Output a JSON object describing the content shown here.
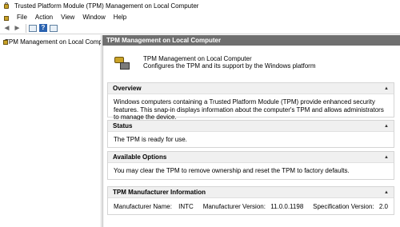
{
  "window": {
    "title": "Trusted Platform Module (TPM) Management on Local Computer"
  },
  "menu": {
    "items": [
      "File",
      "Action",
      "View",
      "Window",
      "Help"
    ]
  },
  "toolbar": {
    "back": "◄",
    "forward": "►",
    "help_glyph": "?"
  },
  "navigation": {
    "item_label": "TPM Management on Local Comp"
  },
  "content": {
    "header": "TPM Management on Local Computer",
    "intro_title": "TPM Management on Local Computer",
    "intro_subtitle": "Configures the TPM and its support by the Windows platform",
    "sections": {
      "overview": {
        "title": "Overview",
        "text": "Windows computers containing a Trusted Platform Module (TPM) provide enhanced security features. This snap-in displays information about the computer's TPM and allows administrators to manage the device."
      },
      "status": {
        "title": "Status",
        "text": "The TPM is ready for use."
      },
      "options": {
        "title": "Available Options",
        "text": "You may clear the TPM to remove ownership and reset the TPM to factory defaults."
      },
      "manufacturer": {
        "title": "TPM Manufacturer Information",
        "name_label": "Manufacturer Name:",
        "name_value": "INTC",
        "version_label": "Manufacturer Version:",
        "version_value": "11.0.0.1198",
        "spec_label": "Specification Version:",
        "spec_value": "2.0"
      }
    }
  }
}
